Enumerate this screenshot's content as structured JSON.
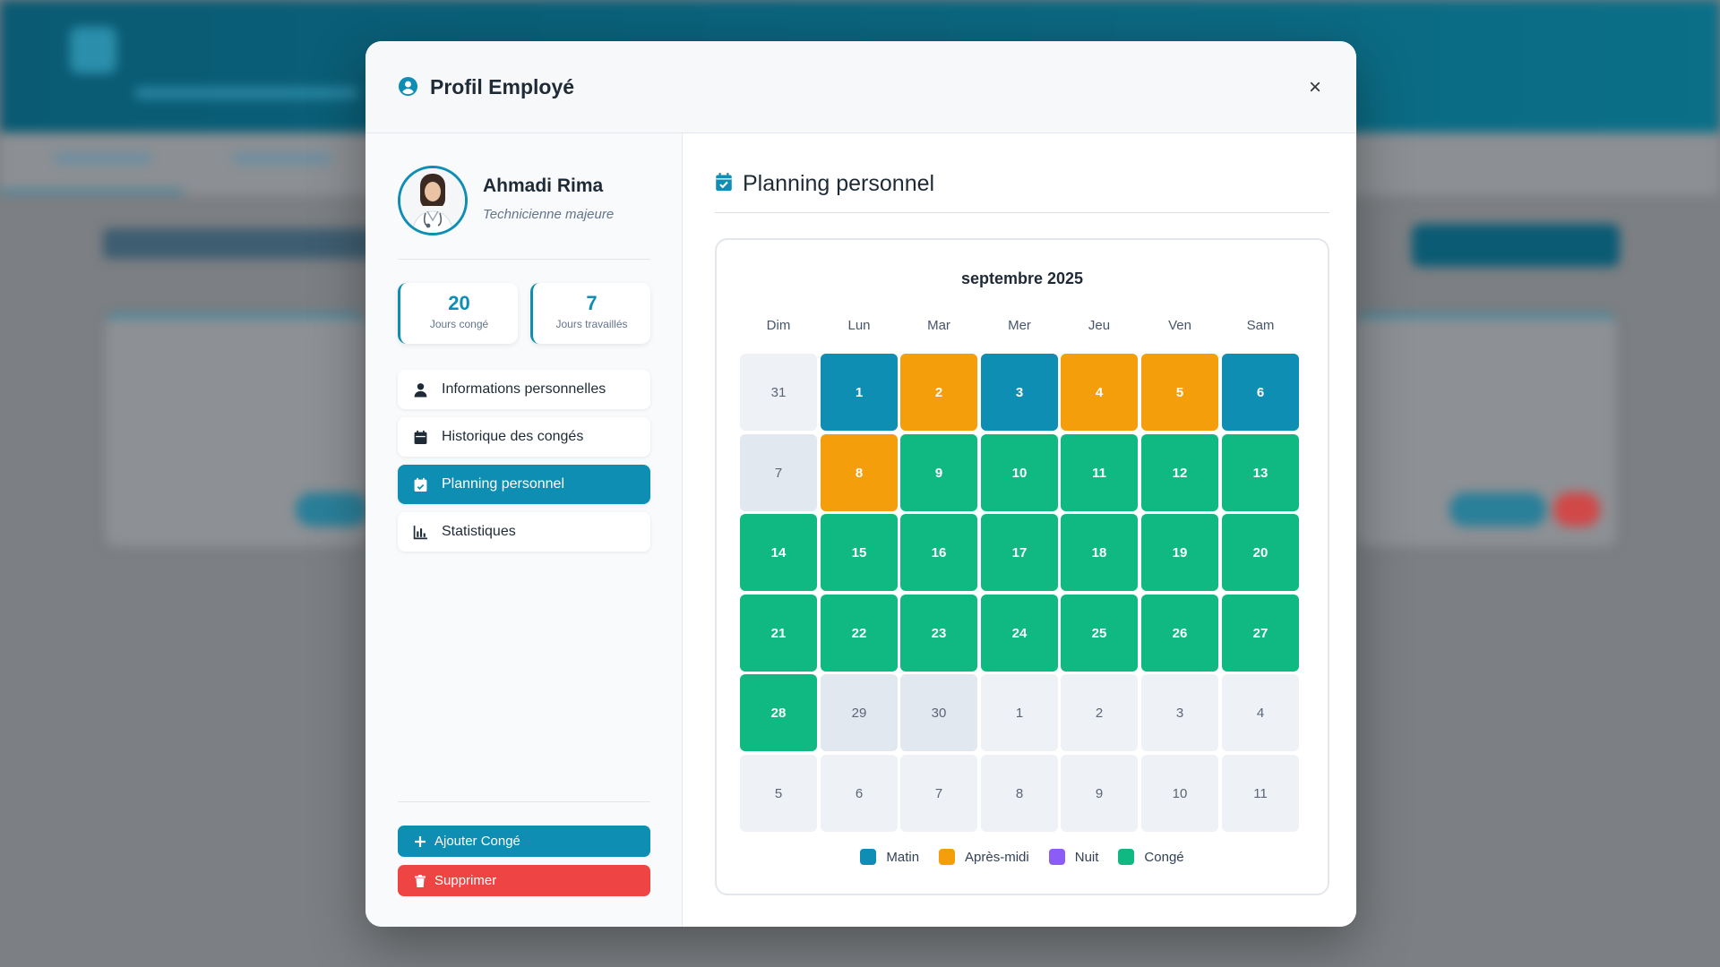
{
  "colors": {
    "accent": "#0e8eb3",
    "matin": "#0e8eb3",
    "apres_midi": "#f59e0b",
    "nuit": "#8b5cf6",
    "conge": "#10b981",
    "danger": "#ef4444"
  },
  "modal": {
    "title": "Profil Employé",
    "title_icon": "user-circle-icon",
    "close_icon": "close-icon"
  },
  "employee": {
    "name": "Ahmadi Rima",
    "role": "Technicienne majeure"
  },
  "stats": [
    {
      "value": "20",
      "label": "Jours congé"
    },
    {
      "value": "7",
      "label": "Jours travaillés"
    }
  ],
  "nav": [
    {
      "label": "Informations personnelles",
      "icon": "user-icon",
      "active": false
    },
    {
      "label": "Historique des congés",
      "icon": "calendar-icon",
      "active": false
    },
    {
      "label": "Planning personnel",
      "icon": "calendar-check-icon",
      "active": true
    },
    {
      "label": "Statistiques",
      "icon": "bar-chart-icon",
      "active": false
    }
  ],
  "actions": {
    "add_label": "Ajouter Congé",
    "add_icon": "plus-icon",
    "delete_label": "Supprimer",
    "delete_icon": "trash-icon"
  },
  "section": {
    "title": "Planning personnel",
    "icon": "calendar-check-icon"
  },
  "calendar": {
    "month": "septembre 2025",
    "weekdays": [
      "Dim",
      "Lun",
      "Mar",
      "Mer",
      "Jeu",
      "Ven",
      "Sam"
    ],
    "weeks": [
      [
        {
          "day": "31",
          "type": "other"
        },
        {
          "day": "1",
          "type": "matin"
        },
        {
          "day": "2",
          "type": "apres"
        },
        {
          "day": "3",
          "type": "matin"
        },
        {
          "day": "4",
          "type": "apres"
        },
        {
          "day": "5",
          "type": "apres"
        },
        {
          "day": "6",
          "type": "matin"
        }
      ],
      [
        {
          "day": "7",
          "type": "past"
        },
        {
          "day": "8",
          "type": "apres"
        },
        {
          "day": "9",
          "type": "conge"
        },
        {
          "day": "10",
          "type": "conge"
        },
        {
          "day": "11",
          "type": "conge"
        },
        {
          "day": "12",
          "type": "conge"
        },
        {
          "day": "13",
          "type": "conge"
        }
      ],
      [
        {
          "day": "14",
          "type": "conge"
        },
        {
          "day": "15",
          "type": "conge"
        },
        {
          "day": "16",
          "type": "conge"
        },
        {
          "day": "17",
          "type": "conge"
        },
        {
          "day": "18",
          "type": "conge"
        },
        {
          "day": "19",
          "type": "conge"
        },
        {
          "day": "20",
          "type": "conge"
        }
      ],
      [
        {
          "day": "21",
          "type": "conge"
        },
        {
          "day": "22",
          "type": "conge"
        },
        {
          "day": "23",
          "type": "conge"
        },
        {
          "day": "24",
          "type": "conge"
        },
        {
          "day": "25",
          "type": "conge"
        },
        {
          "day": "26",
          "type": "conge"
        },
        {
          "day": "27",
          "type": "conge"
        }
      ],
      [
        {
          "day": "28",
          "type": "conge"
        },
        {
          "day": "29",
          "type": "past"
        },
        {
          "day": "30",
          "type": "past"
        },
        {
          "day": "1",
          "type": "other"
        },
        {
          "day": "2",
          "type": "other"
        },
        {
          "day": "3",
          "type": "other"
        },
        {
          "day": "4",
          "type": "other"
        }
      ],
      [
        {
          "day": "5",
          "type": "other"
        },
        {
          "day": "6",
          "type": "other"
        },
        {
          "day": "7",
          "type": "other"
        },
        {
          "day": "8",
          "type": "other"
        },
        {
          "day": "9",
          "type": "other"
        },
        {
          "day": "10",
          "type": "other"
        },
        {
          "day": "11",
          "type": "other"
        }
      ]
    ],
    "legend": [
      {
        "label": "Matin",
        "color": "#0e8eb3"
      },
      {
        "label": "Après-midi",
        "color": "#f59e0b"
      },
      {
        "label": "Nuit",
        "color": "#8b5cf6"
      },
      {
        "label": "Congé",
        "color": "#10b981"
      }
    ]
  }
}
